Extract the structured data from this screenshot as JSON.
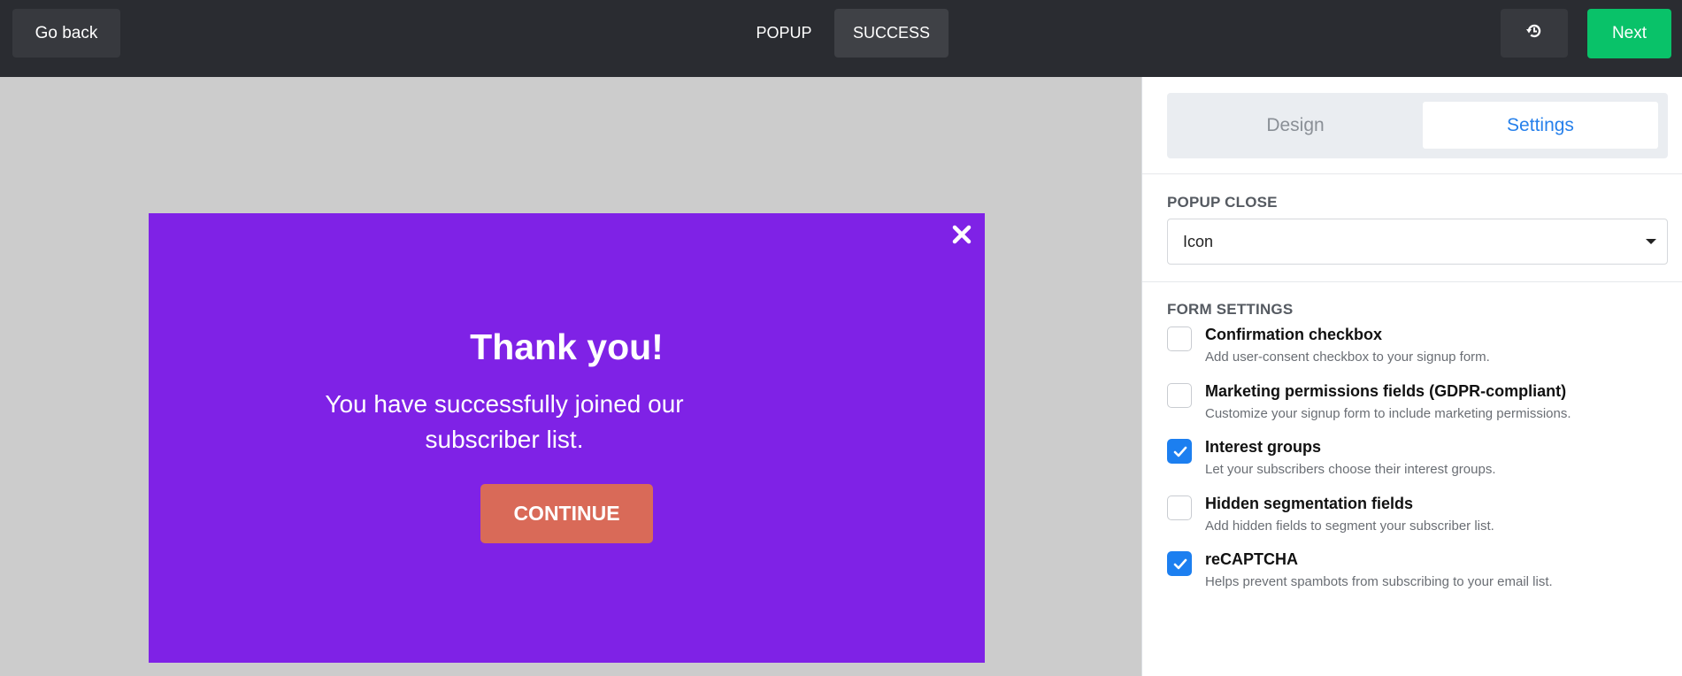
{
  "topbar": {
    "back_label": "Go back",
    "tabs": [
      {
        "label": "POPUP",
        "active": false
      },
      {
        "label": "SUCCESS",
        "active": true
      }
    ],
    "history_icon": "history-icon",
    "next_label": "Next"
  },
  "popup": {
    "background": "#7f22e6",
    "close_icon": "close-icon",
    "title": "Thank you!",
    "message": "You have successfully joined our subscriber list.",
    "button_label": "CONTINUE",
    "button_color": "#d96a58"
  },
  "sidebar": {
    "tabs": [
      {
        "label": "Design",
        "active": false
      },
      {
        "label": "Settings",
        "active": true
      }
    ],
    "popup_close": {
      "label": "POPUP CLOSE",
      "value": "Icon"
    },
    "form_settings": {
      "label": "FORM SETTINGS",
      "options": [
        {
          "title": "Confirmation checkbox",
          "description": "Add user-consent checkbox to your signup form.",
          "checked": false
        },
        {
          "title": "Marketing permissions fields (GDPR-compliant)",
          "description": "Customize your signup form to include marketing permissions.",
          "checked": false
        },
        {
          "title": "Interest groups",
          "description": "Let your subscribers choose their interest groups.",
          "checked": true
        },
        {
          "title": "Hidden segmentation fields",
          "description": "Add hidden fields to segment your subscriber list.",
          "checked": false
        },
        {
          "title": "reCAPTCHA",
          "description": "Helps prevent spambots from subscribing to your email list.",
          "checked": true
        }
      ]
    }
  },
  "colors": {
    "accent": "#2680eb",
    "next": "#09c269",
    "topbar": "#2a2c31",
    "checkbox_checked": "#1c7ff0"
  }
}
